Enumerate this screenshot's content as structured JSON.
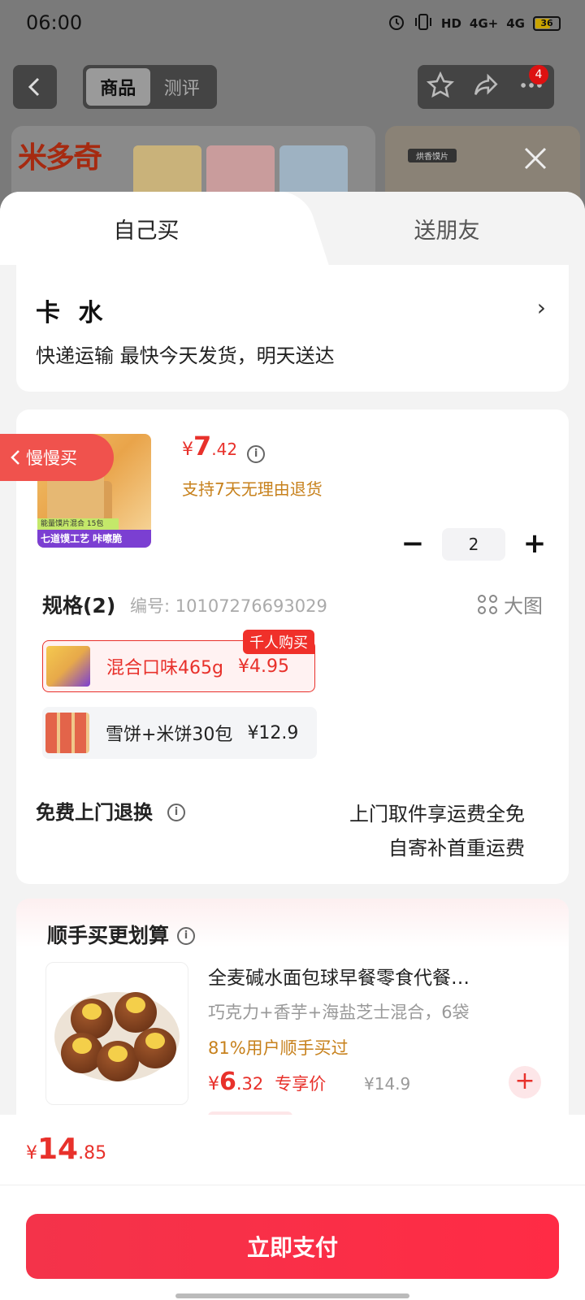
{
  "status_bar": {
    "time": "06:00",
    "network_1": "4G+",
    "network_2": "4G",
    "hd_label": "HD",
    "battery": "36"
  },
  "background_nav": {
    "segment_tabs": [
      {
        "label": "商品"
      },
      {
        "label": "测评"
      }
    ],
    "notification_count": "4",
    "banner_tag": "烘香馍片"
  },
  "sheet": {
    "tabs": [
      {
        "label": "自己买"
      },
      {
        "label": "送朋友"
      }
    ],
    "address": {
      "name": "卡  水",
      "arrow": "›",
      "delivery": "快递运输 最快今天发货，明天送达"
    },
    "product": {
      "slow_tag": "慢慢买",
      "image_label_top": "能量馍片混合 15包",
      "image_label_bottom": "七道馍工艺 咔嚓脆",
      "price": {
        "currency": "¥",
        "integer": "7",
        "decimal": ".42"
      },
      "return_policy": "支持7天无理由退货",
      "quantity": "2",
      "spec": {
        "title": "规格(2)",
        "code": "编号: 10107276693029",
        "big_image_label": "大图",
        "options": [
          {
            "name": "混合口味465g",
            "price": "¥4.95",
            "badge": "千人购买",
            "selected": true
          },
          {
            "name": "雪饼+米饼30包",
            "price": "¥12.9",
            "selected": false
          }
        ]
      },
      "free_return": {
        "title": "免费上门退换",
        "desc_line1": "上门取件享运费全免",
        "desc_line2": "自寄补首重运费"
      }
    },
    "bundle": {
      "title": "顺手买更划算",
      "item": {
        "name": "全麦碱水面包球早餐零食代餐…",
        "variant": "巧克力+香芋+海盐芝士混合，6袋",
        "bought": "81%用户顺手买过",
        "price": {
          "currency": "¥",
          "integer": "6",
          "decimal": ".32"
        },
        "price_label": "专享价",
        "original_price": "¥14.9"
      }
    }
  },
  "footer": {
    "total": {
      "currency": "¥",
      "integer": "14",
      "decimal": ".85"
    },
    "pay_button": "立即支付"
  },
  "colors": {
    "accent": "#e8312b",
    "pay_button": "#f4334a",
    "policy_text": "#c7811c",
    "slow_tag": "#f0524d"
  }
}
